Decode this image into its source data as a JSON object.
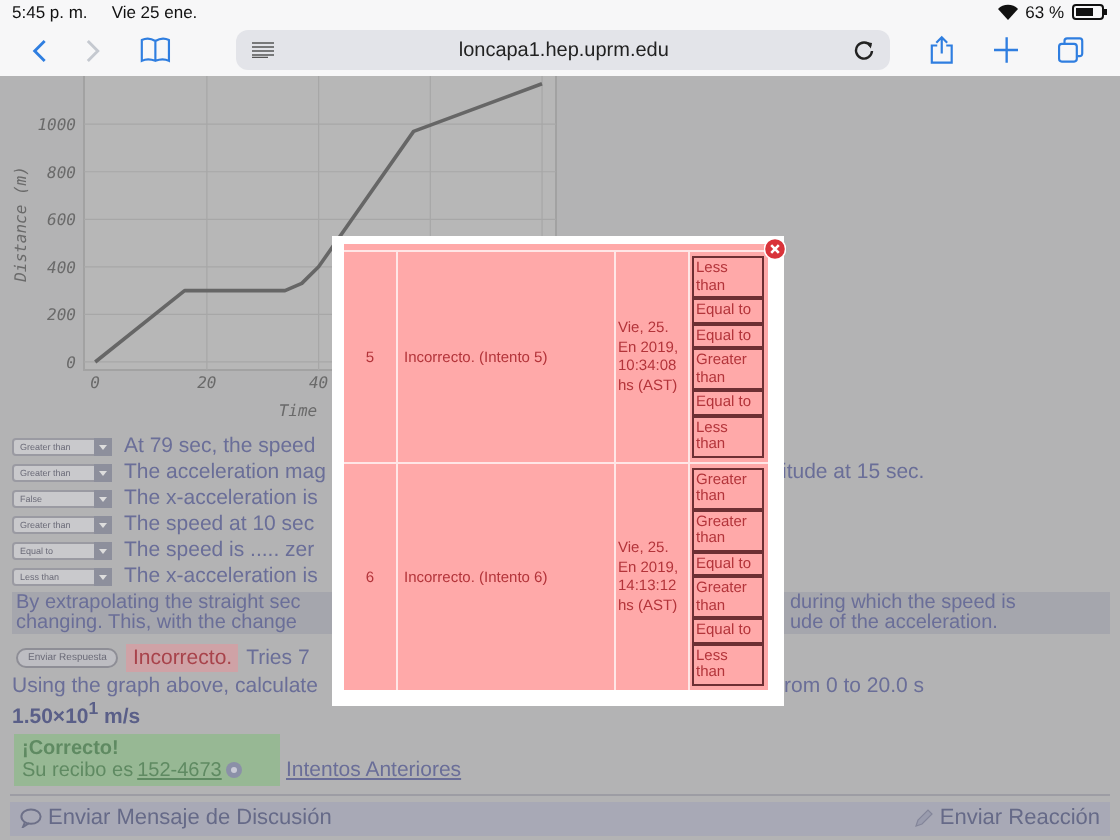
{
  "status_bar": {
    "time": "5:45 p. m.",
    "date": "Vie 25 ene.",
    "battery": "63 %"
  },
  "browser": {
    "url": "loncapa1.hep.uprm.edu"
  },
  "chart": {
    "chart_data": {
      "type": "line",
      "xlabel": "Time",
      "ylabel": "Distance (m)",
      "xticks": [
        0,
        20,
        40
      ],
      "xlim": [
        -2,
        82.5
      ],
      "ylim": [
        -34,
        1250
      ],
      "grid": true,
      "yticks": [
        0,
        200,
        400,
        600,
        800,
        1000
      ],
      "x": [
        0,
        16,
        34,
        37,
        40,
        57,
        80
      ],
      "series": [
        {
          "color": "#666666",
          "values": [
            0,
            300,
            300,
            330,
            400,
            970,
            1170
          ]
        }
      ]
    }
  },
  "questions": [
    {
      "answer": "Greater than",
      "text": "At 79 sec, the speed"
    },
    {
      "answer": "Greater than",
      "text": "The acceleration mag",
      "text_right": "itude at 15 sec."
    },
    {
      "answer": "False",
      "text": "The x-acceleration is"
    },
    {
      "answer": "Greater than",
      "text": "The speed at 10 sec"
    },
    {
      "answer": "Equal to",
      "text": "The speed is ..... zer"
    },
    {
      "answer": "Less than",
      "text": "The x-acceleration is"
    }
  ],
  "explanation": [
    {
      "left": "By extrapolating the straight sec",
      "right": "during which the speed is"
    },
    {
      "left": "changing. This, with the change",
      "right": "ude of the acceleration."
    }
  ],
  "submit": {
    "button": "Enviar Respuesta",
    "result": "Incorrecto.",
    "tries": "Tries 7"
  },
  "question2": {
    "left": "Using the graph above, calculate",
    "right": "rom 0 to 20.0 s",
    "answer": "1.50×10$^{1}$ m/s",
    "result_title": "¡Correcto!",
    "receipt_label": "Su recibo es",
    "receipt": "152-4673",
    "previous_link": "Intentos Anteriores"
  },
  "footer": {
    "discussion": "Enviar Mensaje de Discusión",
    "feedback": "Enviar Reacción"
  },
  "modal": {
    "rows": [
      {
        "number": "5",
        "result": "Incorrecto. (Intento 5)",
        "date": "Vie, 25. En 2019, 10:34:08 hs (AST)",
        "answers": [
          "Less than",
          "Equal to",
          "Equal to",
          "Greater than",
          "Equal to",
          "Less than"
        ]
      },
      {
        "number": "6",
        "result": "Incorrecto. (Intento 6)",
        "date": "Vie, 25. En 2019, 14:13:12 hs (AST)",
        "answers": [
          "Greater than",
          "Greater than",
          "Equal to",
          "Greater than",
          "Equal to",
          "Less than"
        ]
      }
    ]
  }
}
